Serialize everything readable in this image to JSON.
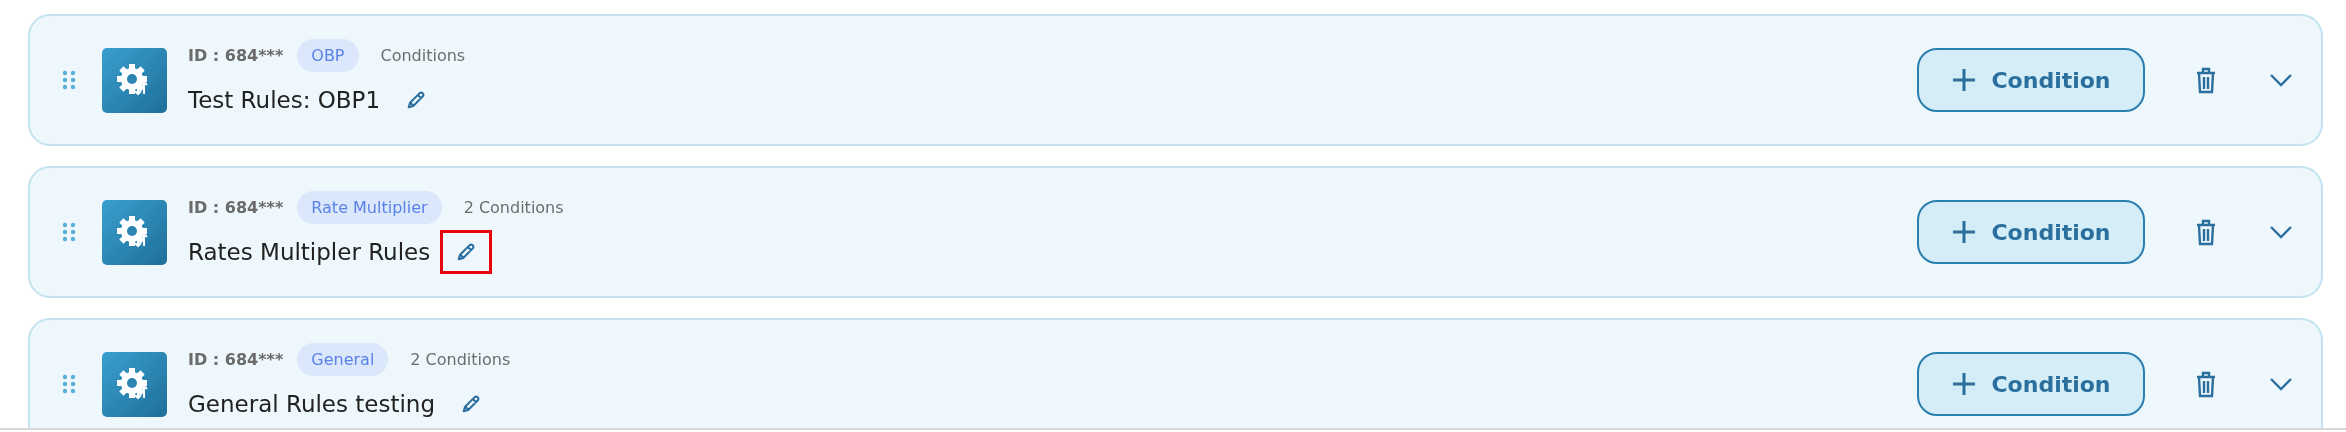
{
  "rules": [
    {
      "id": "ID : 684***",
      "tag": "OBP",
      "conditions": "Conditions",
      "name": "Test Rules: OBP1",
      "edit_highlighted": false,
      "button": "Condition"
    },
    {
      "id": "ID : 684***",
      "tag": "Rate Multiplier",
      "conditions": "2 Conditions",
      "name": "Rates Multipler Rules",
      "edit_highlighted": true,
      "button": "Condition"
    },
    {
      "id": "ID : 684***",
      "tag": "General",
      "conditions": "2 Conditions",
      "name": "General Rules testing",
      "edit_highlighted": false,
      "button": "Condition"
    }
  ]
}
